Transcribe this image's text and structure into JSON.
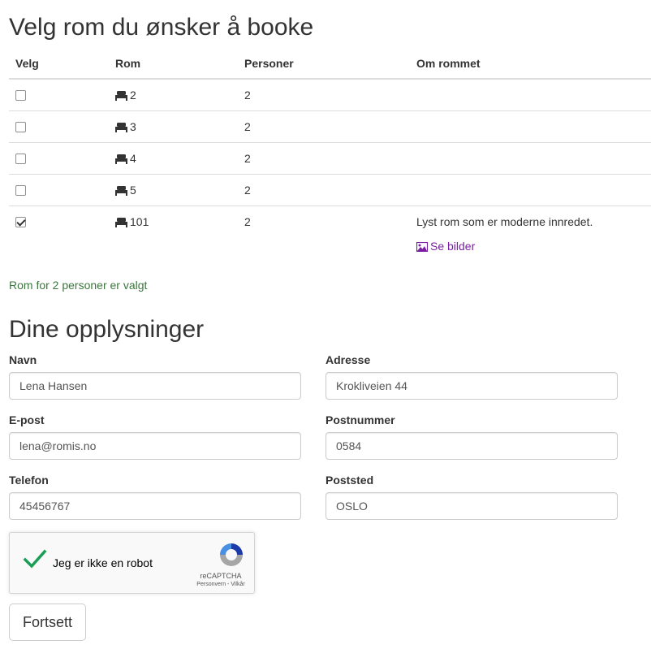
{
  "rooms_section": {
    "title": "Velg rom du ønsker å booke",
    "columns": [
      "Velg",
      "Rom",
      "Personer",
      "Om rommet"
    ],
    "rows": [
      {
        "room": "2",
        "persons": "2",
        "about": "",
        "checked": false
      },
      {
        "room": "3",
        "persons": "2",
        "about": "",
        "checked": false
      },
      {
        "room": "4",
        "persons": "2",
        "about": "",
        "checked": false
      },
      {
        "room": "5",
        "persons": "2",
        "about": "",
        "checked": false
      },
      {
        "room": "101",
        "persons": "2",
        "about": "Lyst rom som er moderne innredet.",
        "checked": true,
        "link": "Se bilder"
      }
    ],
    "selected_message": "Rom for 2 personer er valgt"
  },
  "info_section": {
    "title": "Dine opplysninger",
    "fields": {
      "name": {
        "label": "Navn",
        "value": "Lena Hansen"
      },
      "address": {
        "label": "Adresse",
        "value": "Krokliveien 44"
      },
      "email": {
        "label": "E-post",
        "value": "lena@romis.no"
      },
      "postcode": {
        "label": "Postnummer",
        "value": "0584"
      },
      "phone": {
        "label": "Telefon",
        "value": "45456767"
      },
      "city": {
        "label": "Poststed",
        "value": "OSLO"
      }
    }
  },
  "captcha": {
    "label": "Jeg er ikke en robot",
    "brand": "reCAPTCHA",
    "terms": "Personvern - Vilkår",
    "checked": true
  },
  "actions": {
    "continue_label": "Fortsett"
  },
  "colors": {
    "success_text": "#3c763d",
    "link": "#7b1fa2",
    "captcha_check": "#1a9e55"
  }
}
